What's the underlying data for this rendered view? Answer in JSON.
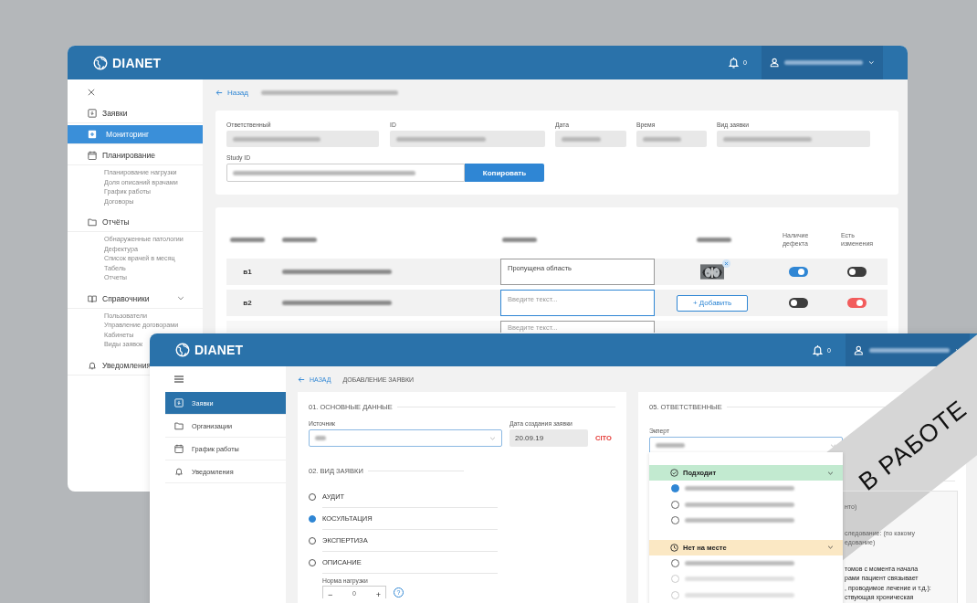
{
  "back_window": {
    "logo": "DIANET",
    "notifications": "0",
    "sidebar": [
      {
        "label": "Заявки",
        "selected": false
      },
      {
        "label": "Мониторинг",
        "selected": true
      },
      {
        "label": "Планирование",
        "selected": false,
        "children": [
          {
            "label": "Планирование нагрузки"
          },
          {
            "label": "Доля описаний врачами"
          },
          {
            "label": "График работы"
          },
          {
            "label": "Договоры"
          }
        ]
      },
      {
        "label": "Отчёты",
        "selected": false,
        "children": [
          {
            "label": "Обнаруженные патологии"
          },
          {
            "label": "Дефектура"
          },
          {
            "label": "Список врачей в месяц"
          },
          {
            "label": "Табель"
          },
          {
            "label": "Отчеты"
          }
        ]
      },
      {
        "label": "Справочники",
        "selected": false,
        "expanded": true,
        "children": [
          {
            "label": "Пользователи"
          },
          {
            "label": "Управление договорами"
          },
          {
            "label": "Кабинеты"
          },
          {
            "label": "Виды заявок"
          }
        ]
      },
      {
        "label": "Уведомления",
        "selected": false
      }
    ],
    "back_link": "Назад",
    "info_fields": [
      {
        "label": "Ответственный"
      },
      {
        "label": "ID"
      },
      {
        "label": "Дата"
      },
      {
        "label": "Время"
      },
      {
        "label": "Вид заявки"
      }
    ],
    "study_id_label": "Study ID",
    "copy_button": "Копировать",
    "table": {
      "columns": [
        null,
        null,
        null,
        null,
        "Наличие дефекта",
        "Есть изменения"
      ],
      "rows": [
        {
          "defect": "в1",
          "comment": "Пропущена область",
          "screenshot": true,
          "has_defect": true,
          "changed": false
        },
        {
          "defect": "в2",
          "placeholder": "Введите текст...",
          "focused": true,
          "add_button": "+ Добавить",
          "has_defect": false,
          "changed": true
        },
        {
          "placeholder": "Введите текст..."
        }
      ]
    }
  },
  "front_window": {
    "logo": "DIANET",
    "notifications": "0",
    "sidebar": [
      {
        "label": "Заявки",
        "selected": true
      },
      {
        "label": "Организации",
        "selected": false
      },
      {
        "label": "График работы",
        "selected": false
      },
      {
        "label": "Уведомления",
        "selected": false
      }
    ],
    "back_link": "НАЗАД",
    "page_title": "ДОБАВЛЕНИЕ ЗАЯВКИ",
    "section_1": {
      "title": "01. ОСНОВНЫЕ ДАННЫЕ",
      "source_label": "Источник",
      "date_label": "Дата создания заявки",
      "date_value": "20.09.19",
      "cito": "CITO"
    },
    "section_2": {
      "title": "02. ВИД ЗАЯВКИ",
      "options": [
        {
          "label": "АУДИТ",
          "selected": false
        },
        {
          "label": "КОСУЛЬТАЦИЯ",
          "selected": true
        },
        {
          "label": "ЭКСПЕРТИЗА",
          "selected": false
        },
        {
          "label": "ОПИСАНИЕ",
          "selected": false
        }
      ],
      "load_label": "Норма нагрузки",
      "minus": "−",
      "load_value": "0",
      "plus": "+",
      "help": "?"
    },
    "section_5": {
      "title": "05. ОТВЕТСТВЕННЫЕ",
      "expert_label": "Экперт",
      "groups": [
        {
          "label": "Подходит",
          "kind": "available",
          "options": [
            {
              "selected": true,
              "disabled": false
            },
            {
              "selected": false,
              "disabled": false
            },
            {
              "selected": false,
              "disabled": false
            }
          ]
        },
        {
          "label": "Нет на месте",
          "kind": "absent",
          "options": [
            {
              "selected": false,
              "disabled": false
            },
            {
              "selected": false,
              "disabled": true
            },
            {
              "selected": false,
              "disabled": true
            }
          ]
        }
      ],
      "partial_lines": [
        {
          "text": "нто)",
          "muted": true
        },
        {
          "text": "следование: (по какому",
          "muted": true
        },
        {
          "text": "едование)",
          "muted": true
        },
        {
          "text": "томов с момента начала",
          "muted": false
        },
        {
          "text": "рами пациент связывает",
          "muted": false
        },
        {
          "text": ", проводимое лечение и т.д.):",
          "muted": false
        },
        {
          "text": "ствующая хроническая",
          "muted": false
        }
      ]
    }
  },
  "stamp": "В РАБОТЕ"
}
